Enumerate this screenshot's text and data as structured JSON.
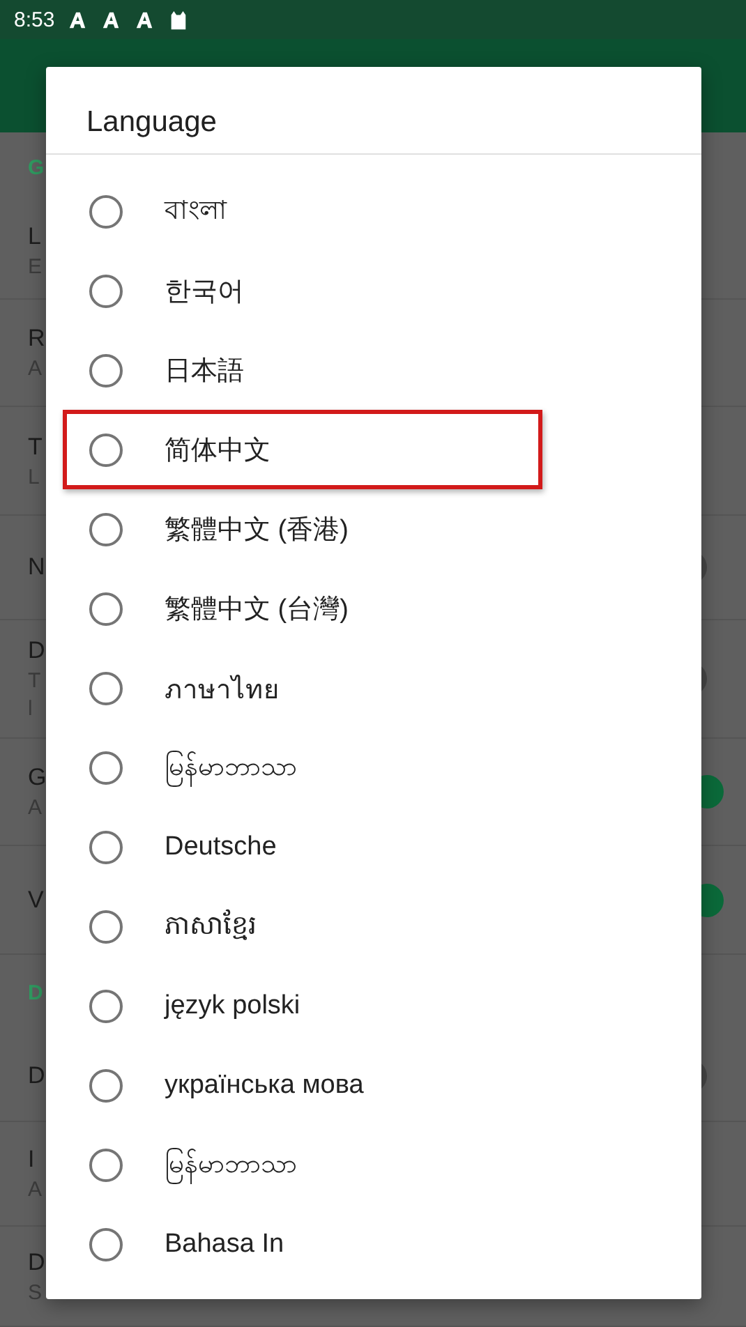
{
  "status_bar": {
    "time": "8:53"
  },
  "background": {
    "rows": [
      {
        "kind": "header",
        "title": "G"
      },
      {
        "kind": "item",
        "title": "L",
        "subtitle": "E"
      },
      {
        "kind": "item",
        "title": "R",
        "subtitle": "A"
      },
      {
        "kind": "item",
        "title": "T",
        "subtitle": "L"
      },
      {
        "kind": "toggle",
        "title": "N",
        "on": false
      },
      {
        "kind": "toggle",
        "title": "D",
        "subtitle": "T",
        "subtitle_2": "l",
        "on": false
      },
      {
        "kind": "toggle",
        "title": "G",
        "subtitle": "A",
        "on": true
      },
      {
        "kind": "toggle",
        "title": "V",
        "on": true
      },
      {
        "kind": "header",
        "title": "D"
      },
      {
        "kind": "toggle",
        "title": "D",
        "on": false
      },
      {
        "kind": "item",
        "title": "I",
        "subtitle": "A"
      },
      {
        "kind": "item",
        "title": "D",
        "subtitle": "S"
      }
    ]
  },
  "dialog": {
    "title": "Language",
    "options": [
      {
        "label": "বাংলা",
        "selected": false,
        "highlighted": false
      },
      {
        "label": "한국어",
        "selected": false,
        "highlighted": false
      },
      {
        "label": "日本語",
        "selected": false,
        "highlighted": false
      },
      {
        "label": "简体中文",
        "selected": false,
        "highlighted": true
      },
      {
        "label": "繁體中文 (香港)",
        "selected": false,
        "highlighted": false
      },
      {
        "label": "繁體中文 (台灣)",
        "selected": false,
        "highlighted": false
      },
      {
        "label": "ภาษาไทย",
        "selected": false,
        "highlighted": false
      },
      {
        "label": "မြန်မာဘာသာ",
        "selected": false,
        "highlighted": false
      },
      {
        "label": "Deutsche",
        "selected": false,
        "highlighted": false
      },
      {
        "label": "ភាសាខ្មែរ",
        "selected": false,
        "highlighted": false
      },
      {
        "label": "język polski",
        "selected": false,
        "highlighted": false
      },
      {
        "label": "українська мова",
        "selected": false,
        "highlighted": false
      },
      {
        "label": "မြန်မာဘာသာ",
        "selected": false,
        "highlighted": false
      },
      {
        "label": "Bahasa In",
        "selected": false,
        "highlighted": false
      }
    ]
  }
}
